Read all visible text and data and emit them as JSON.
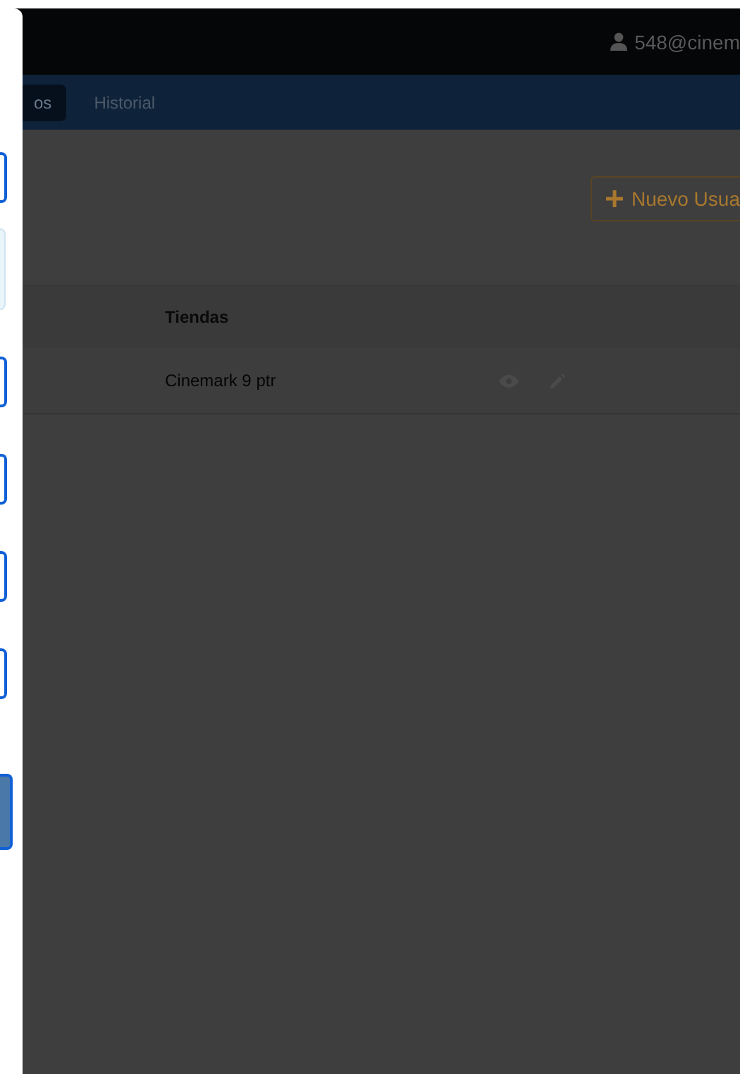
{
  "header": {
    "user": "548@cinem"
  },
  "nav": {
    "tabs": [
      {
        "label": "os",
        "selected": true
      },
      {
        "label": "Historial",
        "selected": false
      }
    ]
  },
  "toolbar": {
    "new_button": "Nuevo Usua"
  },
  "table": {
    "columns": [
      "Tiendas"
    ],
    "rows": [
      {
        "cells": [
          "Cinemark 9 ptr"
        ]
      }
    ]
  },
  "drawer": {
    "items": [
      {
        "kind": "field"
      },
      {
        "kind": "notice"
      },
      {
        "kind": "field"
      },
      {
        "kind": "field"
      },
      {
        "kind": "field"
      },
      {
        "kind": "field"
      },
      {
        "kind": "button"
      }
    ]
  }
}
